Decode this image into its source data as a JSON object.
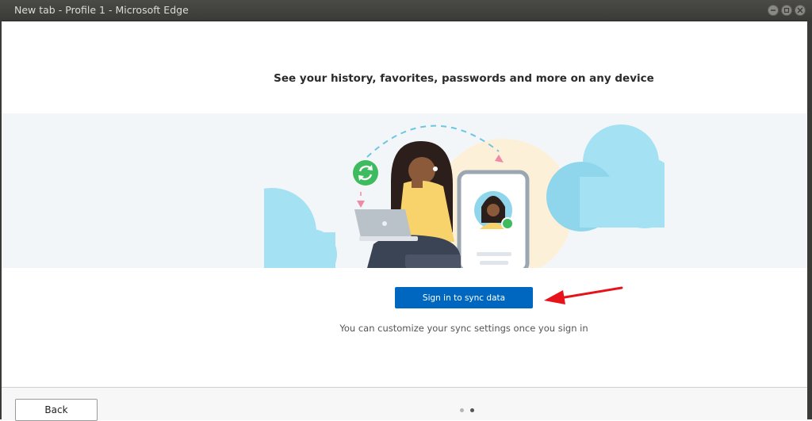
{
  "window": {
    "title": "New tab - Profile 1 - Microsoft Edge"
  },
  "page": {
    "headline": "See your history, favorites, passwords and more on any device",
    "sign_in_button": "Sign in to sync data",
    "hint": "You can customize your sync settings once you sign in",
    "back_button": "Back",
    "pagination": {
      "current": 2,
      "total": 2
    }
  },
  "colors": {
    "accent": "#0067c0",
    "sync_green": "#3dbb5e",
    "cloud": "#a4e1f3",
    "annotation_arrow": "#e8121b"
  },
  "icons": [
    "minimize-icon",
    "maximize-icon",
    "close-icon",
    "sync-icon",
    "laptop-icon",
    "phone-icon",
    "cloud-icon",
    "annotation-arrow-icon"
  ]
}
